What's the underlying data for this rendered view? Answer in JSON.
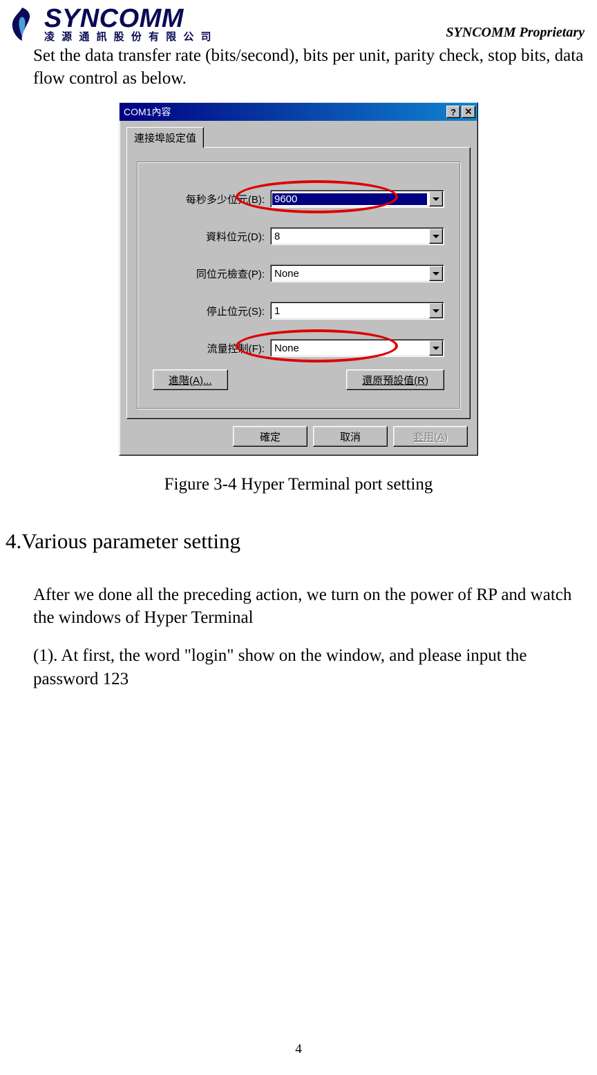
{
  "header": {
    "logo_main": "SYNCOMM",
    "logo_sub": "凌 源 通 訊 股 份 有 限 公 司",
    "proprietary": "SYNCOMM Proprietary"
  },
  "intro_text": "Set the data transfer rate (bits/second), bits per unit, parity check, stop bits, data flow control as below.",
  "dialog": {
    "title": "COM1內容",
    "help_btn": "?",
    "close_btn": "✕",
    "tab_label": "連接埠設定值",
    "fields": {
      "baud": {
        "label": "每秒多少位元(B):",
        "value": "9600"
      },
      "data": {
        "label": "資料位元(D):",
        "value": "8"
      },
      "parity": {
        "label": "同位元檢查(P):",
        "value": "None"
      },
      "stop": {
        "label": "停止位元(S):",
        "value": "1"
      },
      "flow": {
        "label": "流量控制(F):",
        "value": "None"
      }
    },
    "advanced_btn": "進階(A)...",
    "restore_btn": "還原預設值(R)",
    "ok_btn": "確定",
    "cancel_btn": "取消",
    "apply_btn": "套用(A)"
  },
  "figure_caption": "Figure 3-4 Hyper Terminal port setting",
  "section_heading": "4.Various parameter setting",
  "para1": "After we done all the preceding action, we turn on the power of RP and watch the windows of Hyper Terminal",
  "para2": "(1). At first, the word \"login\" show on the window, and please input the password 123",
  "page_number": "4"
}
